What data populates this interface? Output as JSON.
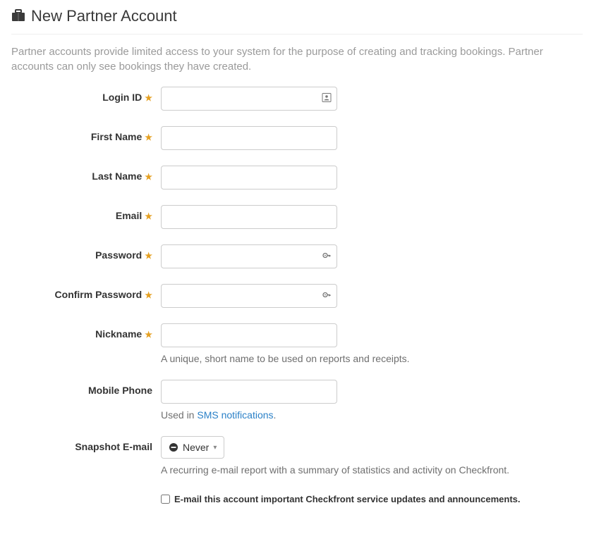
{
  "header": {
    "title": "New Partner Account"
  },
  "description": "Partner accounts provide limited access to your system for the purpose of creating and tracking bookings. Partner accounts can only see bookings they have created.",
  "fields": {
    "login_id": {
      "label": "Login ID",
      "value": ""
    },
    "first_name": {
      "label": "First Name",
      "value": ""
    },
    "last_name": {
      "label": "Last Name",
      "value": ""
    },
    "email": {
      "label": "Email",
      "value": ""
    },
    "password": {
      "label": "Password",
      "value": ""
    },
    "confirm_password": {
      "label": "Confirm Password",
      "value": ""
    },
    "nickname": {
      "label": "Nickname",
      "value": "",
      "help": "A unique, short name to be used on reports and receipts."
    },
    "mobile_phone": {
      "label": "Mobile Phone",
      "value": "",
      "help_prefix": "Used in ",
      "help_link": "SMS notifications",
      "help_suffix": "."
    },
    "snapshot_email": {
      "label": "Snapshot E-mail",
      "selected": "Never",
      "help": "A recurring e-mail report with a summary of statistics and activity on Checkfront."
    },
    "updates_optin": {
      "label": "E-mail this account important Checkfront service updates and announcements.",
      "checked": false
    }
  }
}
